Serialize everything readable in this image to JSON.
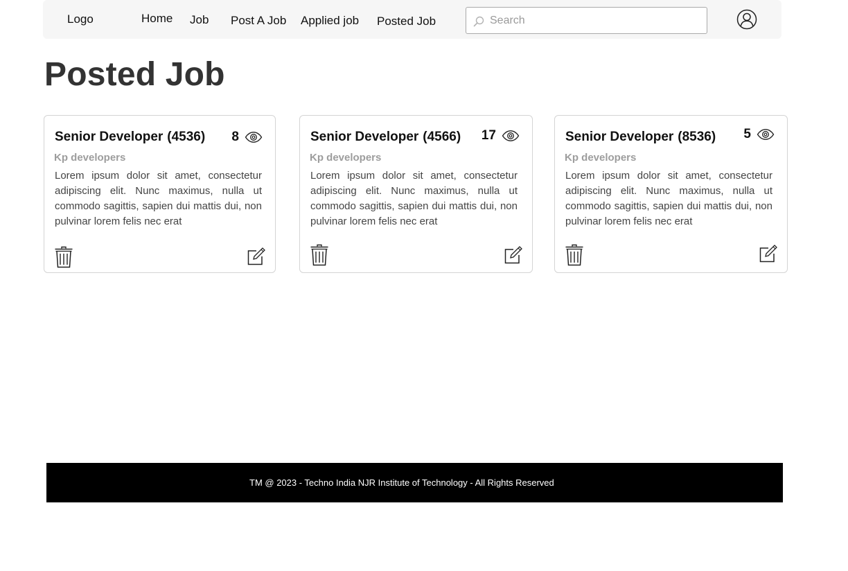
{
  "navbar": {
    "logo": "Logo",
    "links": [
      "Home",
      "Job",
      "Post A Job",
      "Applied job",
      "Posted Job"
    ],
    "search": {
      "placeholder": "Search",
      "value": ""
    },
    "icons": {
      "search": "search-icon",
      "user": "user-icon"
    }
  },
  "page": {
    "title": "Posted Job"
  },
  "cards": [
    {
      "title": "Senior Developer",
      "job_id": "(4536)",
      "views": "8",
      "company": "Kp developers",
      "description": "Lorem ipsum dolor sit amet, consectetur adipiscing elit. Nunc maximus, nulla ut commodo sagittis, sapien dui mattis dui, non pulvinar lorem felis nec erat"
    },
    {
      "title": "Senior Developer",
      "job_id": "(4566)",
      "views": "17",
      "company": "Kp developers",
      "description": "Lorem ipsum dolor sit amet, consectetur adipiscing elit. Nunc maximus, nulla ut commodo sagittis, sapien dui mattis dui, non pulvinar lorem felis nec erat"
    },
    {
      "title": "Senior Developer",
      "job_id": "(8536)",
      "views": "5",
      "company": "Kp developers",
      "description": "Lorem ipsum dolor sit amet, consectetur adipiscing elit. Nunc maximus, nulla ut commodo sagittis, sapien dui mattis dui, non pulvinar lorem felis nec erat"
    }
  ],
  "card_icons": {
    "views": "eye-icon",
    "delete": "trash-icon",
    "edit": "edit-icon"
  },
  "footer": {
    "text": "TM @ 2023 - Techno India NJR Institute of Technology - All Rights Reserved"
  },
  "colors": {
    "navbar_bg": "#f6f6f6",
    "footer_bg": "#000000",
    "title": "#333333",
    "company": "#9d9d9d"
  }
}
